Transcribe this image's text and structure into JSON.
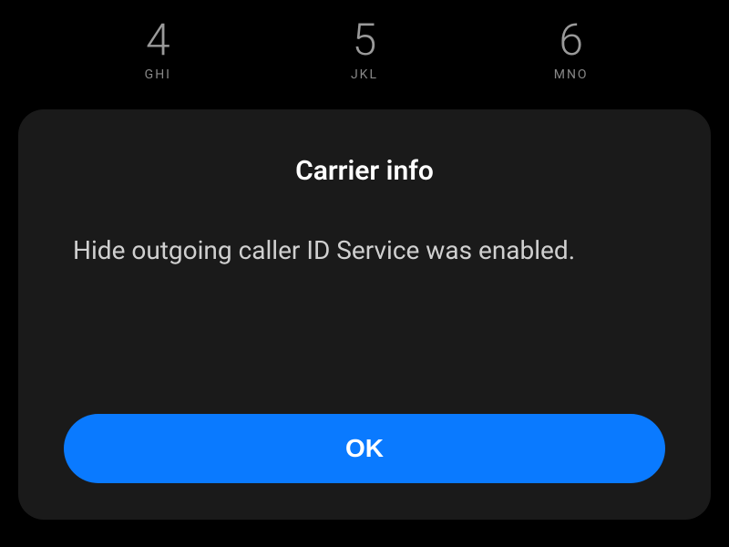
{
  "dialer": {
    "keys": [
      {
        "number": "4",
        "letters": "GHI"
      },
      {
        "number": "5",
        "letters": "JKL"
      },
      {
        "number": "6",
        "letters": "MNO"
      }
    ]
  },
  "dialog": {
    "title": "Carrier info",
    "message": "Hide outgoing caller ID Service was enabled.",
    "ok_label": "OK"
  },
  "colors": {
    "background": "#000000",
    "dialog_bg": "#1a1a1a",
    "button_bg": "#0a7aff"
  }
}
